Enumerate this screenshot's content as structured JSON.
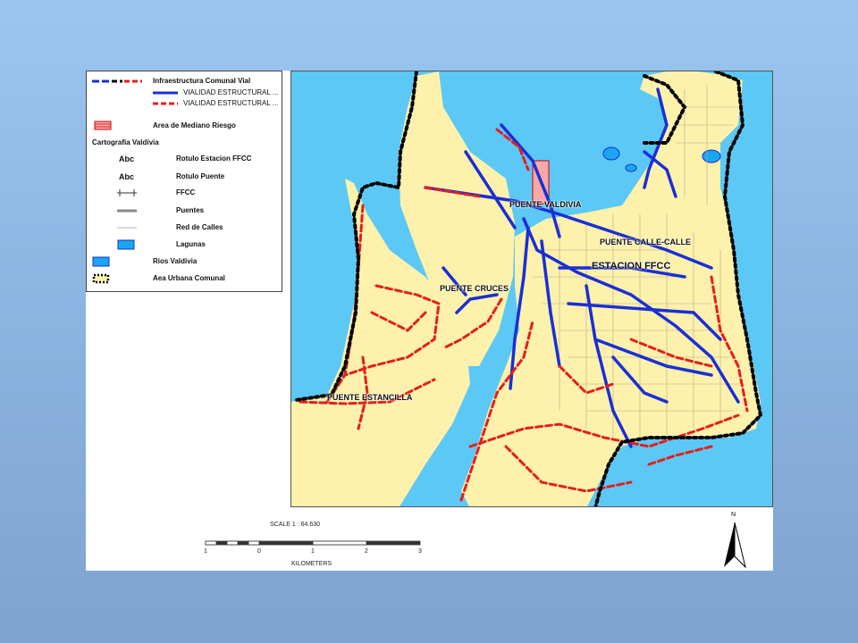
{
  "legend": {
    "title_infra": "Infraestructura Comunal Vial",
    "item_vialidad_blue": "VIALIDAD ESTRUCTURAL ...",
    "item_vialidad_red": "VIALIDAD ESTRUCTURAL ...",
    "item_riesgo": "Area de Mediano Riesgo",
    "title_carto": "Cartografia Valdivia",
    "abc_a": "Abc",
    "abc_b": "Abc",
    "item_rotulo_ffcc": "Rotulo Estacion FFCC",
    "item_rotulo_puente": "Rotulo Puente",
    "item_ffcc": "FFCC",
    "item_puentes": "Puentes",
    "item_red_calles": "Red de Calles",
    "item_lagunas": "Lagunas",
    "item_rios": "Rios Valdivia",
    "item_area_urbana": "Aea Urbana Comunal"
  },
  "map_labels": {
    "puente_valdivia": "PUENTE VALDIVIA",
    "puente_calle_calle": "PUENTE CALLE-CALLE",
    "estacion_ffcc": "ESTACION FFCC",
    "puente_cruces": "PUENTE CRUCES",
    "puente_estancilla": "PUENTE ESTANCILLA"
  },
  "scale": {
    "text": "SCALE 1 : 64.630",
    "units": "KILOMETERS",
    "ticks": [
      "1",
      "0",
      "1",
      "2",
      "3"
    ]
  },
  "north_label": "N",
  "colors": {
    "water": "#5cc8f5",
    "land": "#fdf1ac",
    "blue_road": "#1a2fd6",
    "red_road": "#e41e1e",
    "boundary": "#000000"
  }
}
